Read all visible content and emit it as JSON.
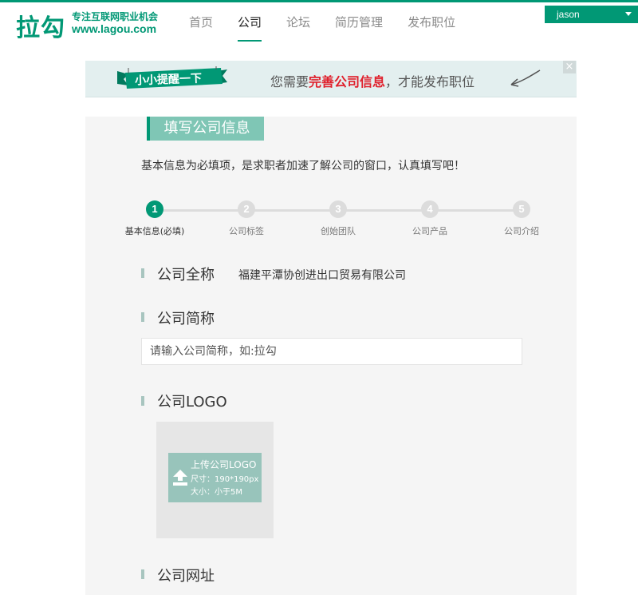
{
  "brand": {
    "logo_text": "拉勾",
    "slogan": "专注互联网职业机会",
    "url": "www.lagou.com",
    "accent_color": "#019875"
  },
  "nav": {
    "items": [
      "首页",
      "公司",
      "论坛",
      "简历管理",
      "发布职位"
    ],
    "active": "公司"
  },
  "user": {
    "name": "jason"
  },
  "banner": {
    "ribbon": "小小提醒一下",
    "msg_prefix": "您需要",
    "msg_highlight": "完善公司信息",
    "msg_suffix": "，才能发布职位",
    "close": "×"
  },
  "form": {
    "title": "填写公司信息",
    "intro": "基本信息为必填项，是求职者加速了解公司的窗口，认真填写吧！",
    "steps": [
      {
        "num": "1",
        "label": "基本信息(必填)",
        "active": true
      },
      {
        "num": "2",
        "label": "公司标签",
        "active": false
      },
      {
        "num": "3",
        "label": "创始团队",
        "active": false
      },
      {
        "num": "4",
        "label": "公司产品",
        "active": false
      },
      {
        "num": "5",
        "label": "公司介绍",
        "active": false
      }
    ],
    "full_name_label": "公司全称",
    "full_name_value": "福建平潭协创进出口贸易有限公司",
    "short_name_label": "公司简称",
    "short_name_placeholder": "请输入公司简称，如:拉勾",
    "logo_label": "公司LOGO",
    "logo_upload_title": "上传公司LOGO",
    "logo_upload_size": "尺寸：190*190px",
    "logo_upload_limit": "大小：小于5M",
    "website_label": "公司网址"
  }
}
